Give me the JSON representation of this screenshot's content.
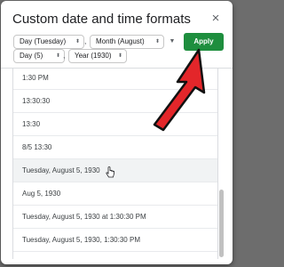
{
  "dialog": {
    "title": "Custom date and time formats",
    "close_symbol": "×"
  },
  "format_chips": [
    {
      "label": "Day (Tuesday)"
    },
    {
      "label": "Month (August)"
    },
    {
      "label": "Day (5)"
    },
    {
      "label": "Year (1930)"
    }
  ],
  "separators": [
    ",",
    ",",
    ","
  ],
  "stepper_symbol": "⬍",
  "dropdown_symbol": "▼",
  "apply_label": "Apply",
  "formats": [
    "1:30 PM",
    "13:30:30",
    "13:30",
    "8/5 13:30",
    "Tuesday, August 5, 1930",
    "Aug 5, 1930",
    "Tuesday, August 5, 1930 at 1:30:30 PM",
    "Tuesday, August 5, 1930, 1:30:30 PM"
  ],
  "colors": {
    "apply": "#1e8e3e",
    "annotation_arrow": "#e3262a",
    "hover_row": "#f1f3f4"
  }
}
